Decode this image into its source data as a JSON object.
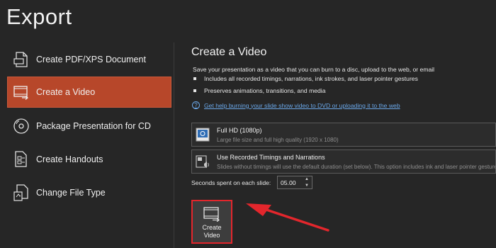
{
  "page": {
    "title": "Export"
  },
  "sidebar": {
    "items": [
      {
        "label": "Create PDF/XPS Document",
        "icon": "pdf-document-icon",
        "selected": false
      },
      {
        "label": "Create a Video",
        "icon": "video-icon",
        "selected": true
      },
      {
        "label": "Package Presentation for CD",
        "icon": "cd-disc-icon",
        "selected": false
      },
      {
        "label": "Create Handouts",
        "icon": "handouts-icon",
        "selected": false
      },
      {
        "label": "Change File Type",
        "icon": "file-type-icon",
        "selected": false
      }
    ],
    "selected_color": "#b7472a"
  },
  "main": {
    "title": "Create a Video",
    "description": "Save your presentation as a video that you can burn to a disc, upload to the web, or email",
    "bullets": [
      "Includes all recorded timings, narrations, ink strokes, and laser pointer gestures",
      "Preserves animations, transitions, and media"
    ],
    "help_link": "Get help burning your slide show video to DVD or uploading it to the web",
    "quality_option": {
      "title": "Full HD (1080p)",
      "subtitle": "Large file size and full high quality (1920 x 1080)"
    },
    "timings_option": {
      "title": "Use Recorded Timings and Narrations",
      "subtitle": "Slides without timings will use the default duration (set below). This option includes ink and laser pointer gestures."
    },
    "seconds": {
      "label": "Seconds spent on each slide:",
      "value": "05.00"
    },
    "create_button": {
      "label": "Create Video",
      "highlight_color": "#e3262c"
    }
  }
}
